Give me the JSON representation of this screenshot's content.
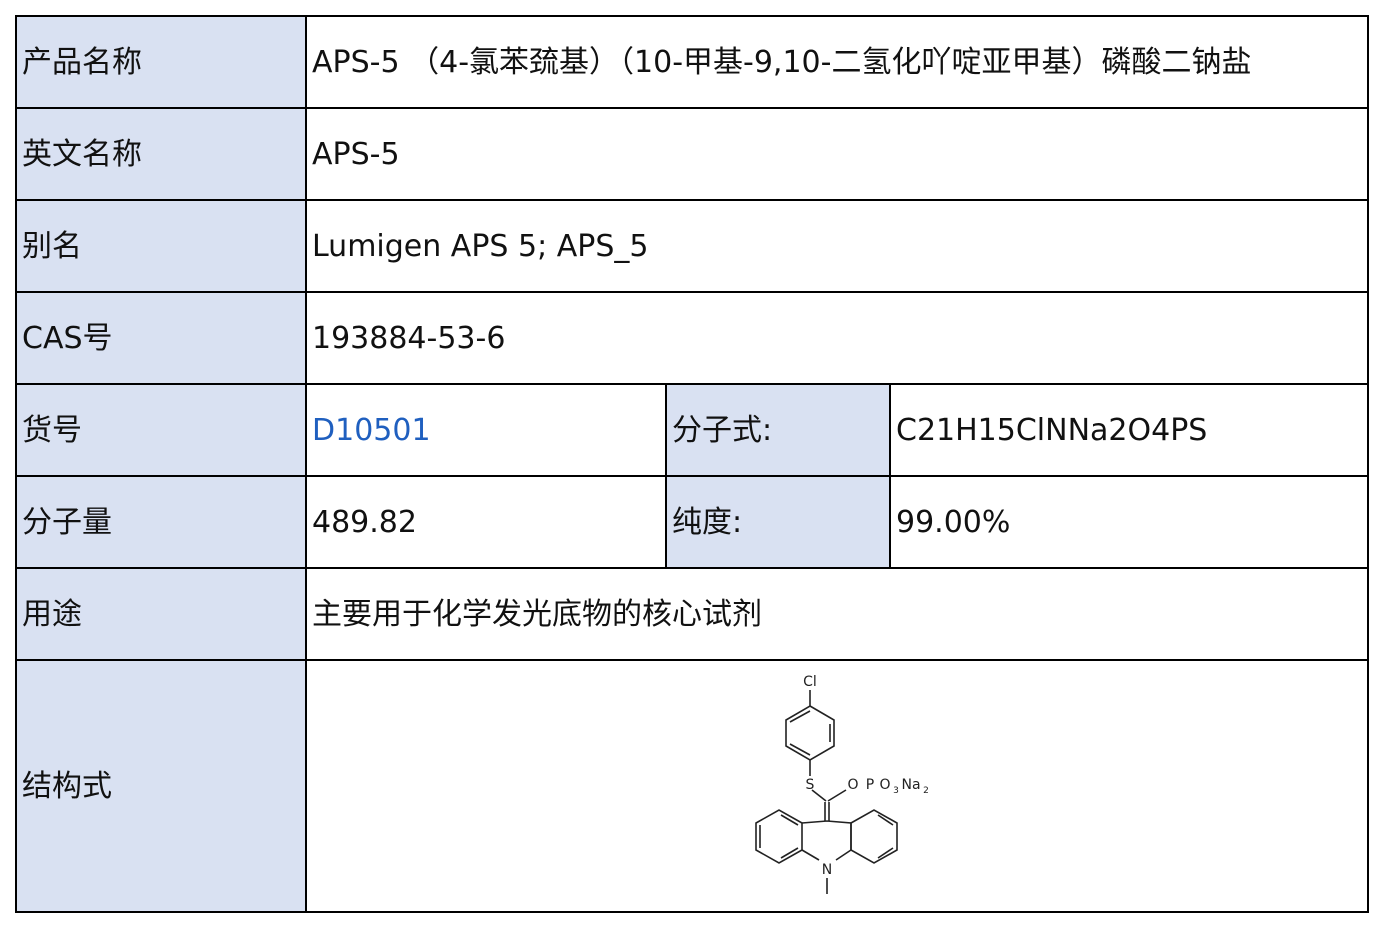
{
  "rows": {
    "product_name": {
      "label": "产品名称",
      "value": "APS-5 （4-氯苯巯基）（10-甲基-9,10-二氢化吖啶亚甲基）磷酸二钠盐"
    },
    "english_name": {
      "label": "英文名称",
      "value": "APS-5"
    },
    "alias": {
      "label": "别名",
      "value": "Lumigen APS 5; APS_5"
    },
    "cas": {
      "label": "CAS号",
      "value": "193884-53-6"
    },
    "item_no": {
      "label": "货号",
      "value": "D10501"
    },
    "formula": {
      "label": "分子式:",
      "value": "C21H15ClNNa2O4PS"
    },
    "mol_weight": {
      "label": "分子量",
      "value": "489.82"
    },
    "purity": {
      "label": "纯度:",
      "value": "99.00%"
    },
    "usage": {
      "label": "用途",
      "value": "主要用于化学发光底物的核心试剂"
    },
    "structure": {
      "label": "结构式"
    }
  },
  "structure_labels": {
    "cl": "Cl",
    "s": "S",
    "o": "O",
    "p": "P",
    "o3": "O",
    "sub3": "3",
    "na": "Na",
    "sub2": "2",
    "n": "N"
  },
  "colors": {
    "label_bg": "#d9e1f2",
    "link": "#1f5fbf",
    "border": "#000000"
  }
}
